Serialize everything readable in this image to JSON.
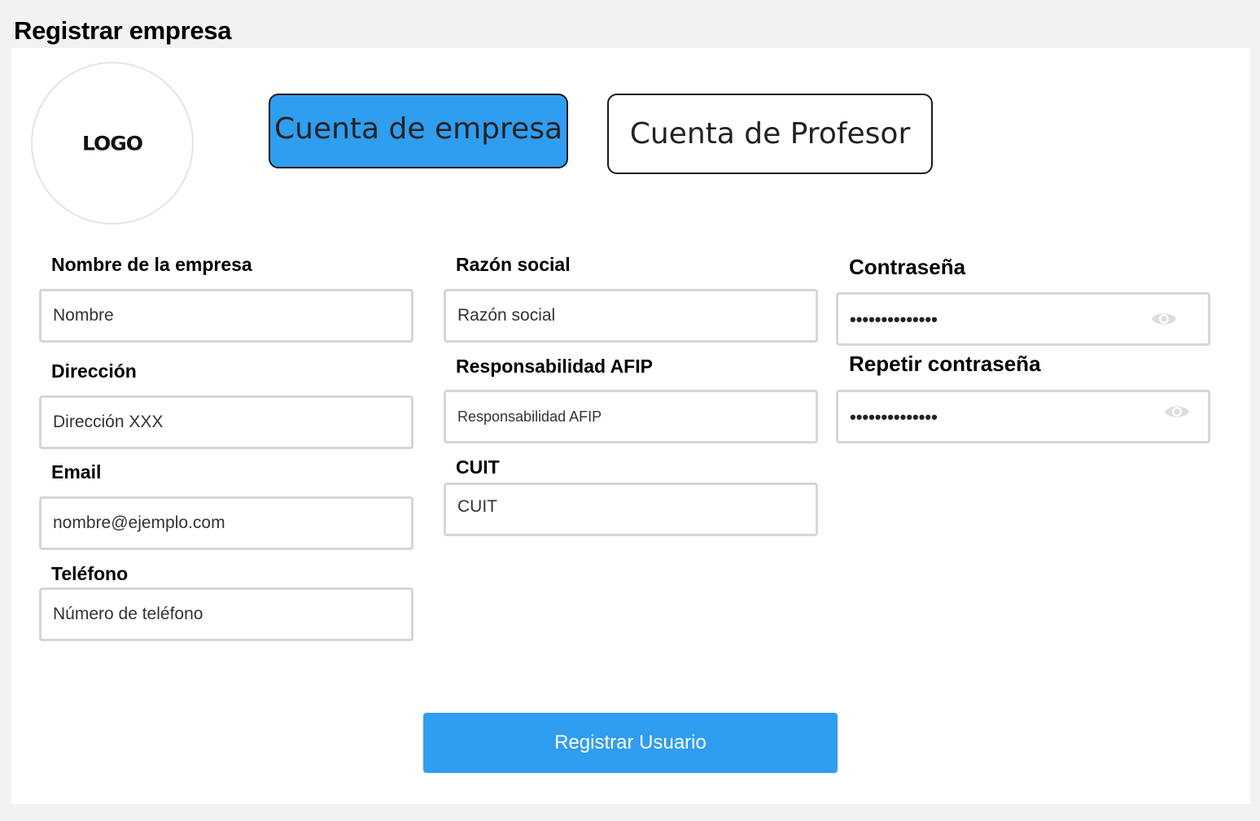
{
  "page": {
    "title": "Registrar empresa"
  },
  "logo": {
    "text": "LOGO"
  },
  "account_tabs": {
    "company_label": "Cuenta de empresa",
    "teacher_label": "Cuenta de Profesor",
    "active": "company",
    "active_color": "#2f9df0"
  },
  "form": {
    "company_name": {
      "label": "Nombre de la empresa",
      "placeholder": "Nombre"
    },
    "address": {
      "label": "Dirección",
      "placeholder": "Dirección XXX"
    },
    "email": {
      "label": "Email",
      "placeholder": "nombre@ejemplo.com"
    },
    "phone": {
      "label": "Teléfono",
      "placeholder": "Número de teléfono"
    },
    "business_name": {
      "label": "Razón social",
      "placeholder": "Razón social"
    },
    "afip": {
      "label": "Responsabilidad AFIP",
      "placeholder": "Responsabilidad AFIP"
    },
    "cuit": {
      "label": "CUIT",
      "placeholder": "CUIT"
    },
    "password": {
      "label": "Contraseña",
      "value": "••••••••••••••",
      "icon": "eye-icon"
    },
    "repeat_password": {
      "label": "Repetir contraseña",
      "value": "••••••••••••••",
      "icon": "eye-icon"
    }
  },
  "submit": {
    "label": "Registrar Usuario",
    "color": "#2f9df0"
  }
}
